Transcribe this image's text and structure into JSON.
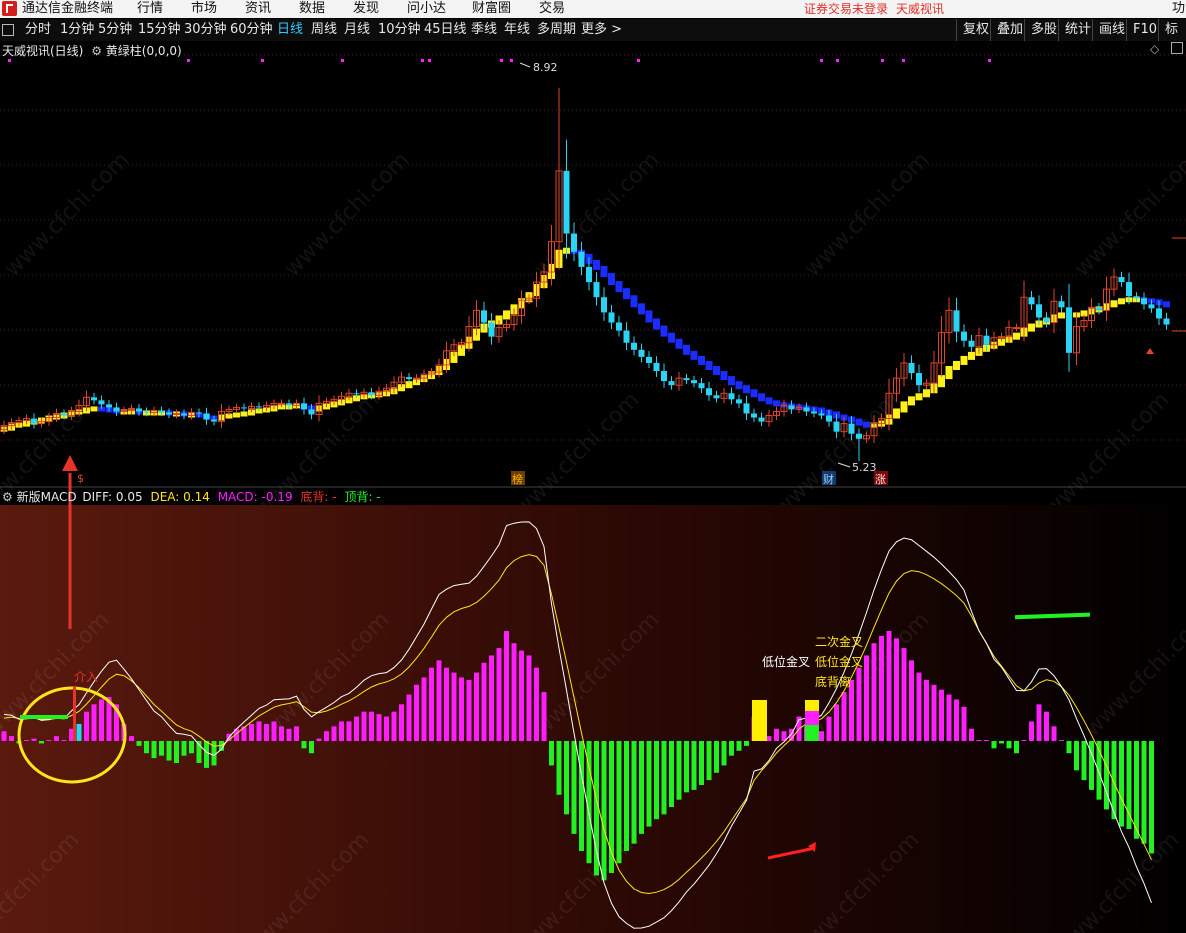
{
  "menubar": {
    "app_name": "通达信金融终端",
    "menus": [
      "行情",
      "市场",
      "资讯",
      "数据",
      "发现",
      "问小达",
      "财富圈",
      "交易"
    ],
    "login_status": "证券交易未登录",
    "brand": "天威视讯",
    "right_edge": "功"
  },
  "toolbar": {
    "periods": [
      "分时",
      "1分钟",
      "5分钟",
      "15分钟",
      "30分钟",
      "60分钟",
      "日线",
      "周线",
      "月线",
      "10分钟",
      "45日线",
      "季线",
      "年线",
      "多周期",
      "更多 >"
    ],
    "active_period": "日线",
    "right_tools": [
      "复权",
      "叠加",
      "多股",
      "统计",
      "画线",
      "F10",
      "标记"
    ]
  },
  "main_chart": {
    "title": "天威视讯(日线)",
    "indicator": "黄绿柱(0,0,0)",
    "high_label": "8.92",
    "low_label": "5.23",
    "markers": [
      "$",
      "榜",
      "财",
      "涨"
    ]
  },
  "macd_panel": {
    "name": "新版MACD",
    "diff_label": "DIFF: 0.05",
    "dea_label": "DEA: 0.14",
    "macd_label": "MACD: -0.19",
    "bottom_div_label": "底背: -",
    "top_div_label": "顶背: -",
    "entry_label": "介入",
    "annotations": {
      "second_cross": "二次金叉",
      "low_cross_1": "低位金叉",
      "low_cross_2": "低位金叉",
      "bottom_divergence": "底背离"
    }
  },
  "watermark": "www.cfchi.com",
  "colors": {
    "up": "#e0442a",
    "down": "#2ad4f4",
    "yellow_line": "#ffef1a",
    "blue_line": "#1a2cff",
    "macd_pos": "#ff1eff",
    "macd_neg": "#21f021",
    "accent": "#2ecbff"
  },
  "chart_data": [
    {
      "type": "candlestick",
      "title": "天威视讯(日线)",
      "ylim": [
        5.23,
        8.92
      ],
      "max_label": 8.92,
      "min_label": 5.23,
      "series": [
        {
          "name": "close",
          "values": [
            5.58,
            5.61,
            5.63,
            5.65,
            5.6,
            5.62,
            5.66,
            5.7,
            5.68,
            5.72,
            5.78,
            5.86,
            5.83,
            5.79,
            5.76,
            5.72,
            5.73,
            5.75,
            5.72,
            5.71,
            5.73,
            5.71,
            5.69,
            5.7,
            5.68,
            5.71,
            5.7,
            5.64,
            5.62,
            5.72,
            5.74,
            5.76,
            5.75,
            5.77,
            5.76,
            5.78,
            5.8,
            5.8,
            5.78,
            5.8,
            5.74,
            5.69,
            5.8,
            5.82,
            5.84,
            5.87,
            5.9,
            5.89,
            5.91,
            5.88,
            5.92,
            5.95,
            6.01,
            6.06,
            6.04,
            6.05,
            6.09,
            6.11,
            6.18,
            6.32,
            6.38,
            6.4,
            6.56,
            6.72,
            6.6,
            6.46,
            6.55,
            6.58,
            6.67,
            6.82,
            6.84,
            7.0,
            7.1,
            7.4,
            8.1,
            7.48,
            7.3,
            7.15,
            7.0,
            6.85,
            6.7,
            6.6,
            6.52,
            6.4,
            6.33,
            6.26,
            6.2,
            6.12,
            6.02,
            5.98,
            6.05,
            6.03,
            6.0,
            5.95,
            5.88,
            5.85,
            5.9,
            5.84,
            5.8,
            5.7,
            5.66,
            5.62,
            5.68,
            5.72,
            5.78,
            5.74,
            5.76,
            5.72,
            5.7,
            5.68,
            5.62,
            5.52,
            5.6,
            5.5,
            5.45,
            5.48,
            5.6,
            5.65,
            5.9,
            6.05,
            6.2,
            6.1,
            5.98,
            6.0,
            6.2,
            6.5,
            6.72,
            6.51,
            6.42,
            6.36,
            6.47,
            6.38,
            6.45,
            6.46,
            6.55,
            6.55,
            6.85,
            6.78,
            6.65,
            6.6,
            6.81,
            6.75,
            6.3,
            6.56,
            6.62,
            6.75,
            6.72,
            6.93,
            7.05,
            7.0,
            6.86,
            6.84,
            6.78,
            6.74,
            6.64,
            6.58
          ]
        },
        {
          "name": "MA (黄绿柱)",
          "values": [
            5.55,
            5.58,
            5.59,
            5.61,
            5.62,
            5.64,
            5.66,
            5.67,
            5.69,
            5.71,
            5.72,
            5.74,
            5.75,
            5.74,
            5.73,
            5.72,
            5.72,
            5.72,
            5.71,
            5.71,
            5.71,
            5.71,
            5.7,
            5.7,
            5.69,
            5.69,
            5.68,
            5.66,
            5.65,
            5.67,
            5.68,
            5.69,
            5.7,
            5.72,
            5.73,
            5.74,
            5.76,
            5.77,
            5.77,
            5.78,
            5.76,
            5.74,
            5.76,
            5.78,
            5.8,
            5.82,
            5.84,
            5.86,
            5.87,
            5.88,
            5.89,
            5.91,
            5.94,
            5.97,
            6.0,
            6.03,
            6.06,
            6.1,
            6.15,
            6.22,
            6.29,
            6.36,
            6.44,
            6.52,
            6.57,
            6.6,
            6.65,
            6.7,
            6.76,
            6.82,
            6.88,
            6.96,
            7.05,
            7.16,
            7.3,
            7.32,
            7.3,
            7.26,
            7.2,
            7.14,
            7.07,
            6.99,
            6.92,
            6.85,
            6.77,
            6.7,
            6.62,
            6.55,
            6.48,
            6.42,
            6.36,
            6.3,
            6.25,
            6.2,
            6.15,
            6.1,
            6.05,
            6.0,
            5.96,
            5.92,
            5.88,
            5.84,
            5.81,
            5.79,
            5.78,
            5.77,
            5.76,
            5.75,
            5.74,
            5.72,
            5.7,
            5.67,
            5.65,
            5.63,
            5.6,
            5.58,
            5.59,
            5.61,
            5.67,
            5.73,
            5.8,
            5.85,
            5.88,
            5.92,
            5.98,
            6.06,
            6.15,
            6.2,
            6.25,
            6.29,
            6.33,
            6.36,
            6.39,
            6.42,
            6.45,
            6.48,
            6.53,
            6.57,
            6.6,
            6.62,
            6.66,
            6.68,
            6.67,
            6.68,
            6.7,
            6.72,
            6.74,
            6.77,
            6.8,
            6.82,
            6.83,
            6.83,
            6.82,
            6.81,
            6.79,
            6.77
          ]
        }
      ]
    },
    {
      "type": "bar",
      "title": "新版MACD",
      "ylim": [
        -0.45,
        0.45
      ],
      "series": [
        {
          "name": "MACD",
          "values": [
            0.04,
            0.02,
            -0.01,
            0.0,
            0.01,
            -0.01,
            0.0,
            0.02,
            0.0,
            0.05,
            0.07,
            0.12,
            0.15,
            0.17,
            0.18,
            0.15,
            0.07,
            0.02,
            -0.02,
            -0.05,
            -0.07,
            -0.06,
            -0.08,
            -0.09,
            -0.06,
            -0.05,
            -0.09,
            -0.11,
            -0.1,
            -0.04,
            0.03,
            0.05,
            0.06,
            0.07,
            0.08,
            0.07,
            0.08,
            0.06,
            0.05,
            0.06,
            -0.03,
            -0.05,
            0.01,
            0.04,
            0.06,
            0.08,
            0.08,
            0.1,
            0.12,
            0.12,
            0.11,
            0.1,
            0.12,
            0.15,
            0.19,
            0.23,
            0.26,
            0.3,
            0.33,
            0.3,
            0.28,
            0.26,
            0.25,
            0.28,
            0.32,
            0.35,
            0.38,
            0.45,
            0.4,
            0.37,
            0.35,
            0.3,
            0.2,
            -0.1,
            -0.22,
            -0.3,
            -0.38,
            -0.45,
            -0.5,
            -0.55,
            -0.57,
            -0.54,
            -0.5,
            -0.45,
            -0.42,
            -0.38,
            -0.35,
            -0.32,
            -0.3,
            -0.27,
            -0.24,
            -0.21,
            -0.2,
            -0.18,
            -0.16,
            -0.13,
            -0.1,
            -0.06,
            -0.04,
            -0.02,
            0.1,
            0.02,
            0.02,
            0.05,
            0.04,
            0.05,
            0.1,
            0.06,
            0.02,
            0.04,
            0.1,
            0.15,
            0.2,
            0.25,
            0.3,
            0.35,
            0.4,
            0.43,
            0.45,
            0.42,
            0.38,
            0.33,
            0.28,
            0.25,
            0.23,
            0.21,
            0.19,
            0.17,
            0.14,
            0.05,
            0.0,
            0.0,
            -0.03,
            -0.01,
            -0.03,
            -0.05,
            0.0,
            0.08,
            0.15,
            0.12,
            0.06,
            0.0,
            -0.05,
            -0.12,
            -0.16,
            -0.2,
            -0.24,
            -0.28,
            -0.32,
            -0.35,
            -0.36,
            -0.4,
            -0.42,
            -0.46
          ]
        }
      ]
    }
  ]
}
